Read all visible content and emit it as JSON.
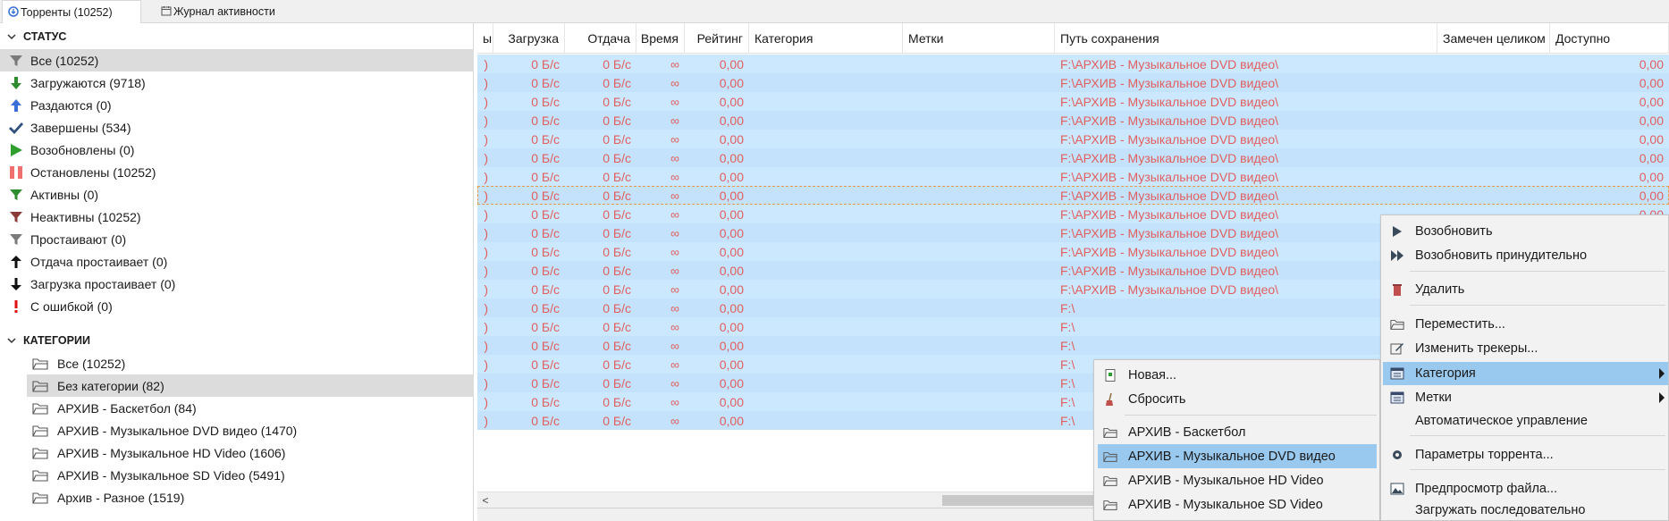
{
  "tabs": [
    {
      "label": "Торренты (10252)",
      "icon": "torrents-icon"
    },
    {
      "label": "Журнал активности",
      "icon": "calendar-icon"
    }
  ],
  "sidebar": {
    "status_header": "СТАТУС",
    "status_items": [
      {
        "label": "Все (10252)",
        "icon": "filter-icon",
        "color": "#7a7a7a"
      },
      {
        "label": "Загружаются (9718)",
        "icon": "download-arrow-icon",
        "color": "#2e8b2e"
      },
      {
        "label": "Раздаются (0)",
        "icon": "upload-arrow-icon",
        "color": "#3a6fd8"
      },
      {
        "label": "Завершены (534)",
        "icon": "checkmark-icon",
        "color": "#2f4f7f"
      },
      {
        "label": "Возобновлены (0)",
        "icon": "play-icon",
        "color": "#2e9e2e"
      },
      {
        "label": "Остановлены (10252)",
        "icon": "pause-icon",
        "color": "#f07070"
      },
      {
        "label": "Активны (0)",
        "icon": "filter-icon",
        "color": "#2e8b2e"
      },
      {
        "label": "Неактивны (10252)",
        "icon": "filter-icon",
        "color": "#8b3a3a"
      },
      {
        "label": "Простаивают (0)",
        "icon": "filter-icon",
        "color": "#7a7a7a"
      },
      {
        "label": "Отдача простаивает (0)",
        "icon": "up-arrow-icon",
        "color": "#111111"
      },
      {
        "label": "Загрузка простаивает (0)",
        "icon": "down-arrow-icon",
        "color": "#111111"
      },
      {
        "label": "С ошибкой (0)",
        "icon": "error-icon",
        "color": "#e01010"
      }
    ],
    "categories_header": "КАТЕГОРИИ",
    "category_items": [
      {
        "label": "Все (10252)"
      },
      {
        "label": "Без категории (82)"
      },
      {
        "label": "АРХИВ - Баскетбол (84)"
      },
      {
        "label": "АРХИВ - Музыкальное DVD видео (1470)"
      },
      {
        "label": "АРХИВ - Музыкальное HD Video (1606)"
      },
      {
        "label": "АРХИВ - Музыкальное SD Video (5491)"
      },
      {
        "label": "Архив - Разное (1519)"
      }
    ]
  },
  "table": {
    "columns": {
      "c0": "ы",
      "download": "Загрузка",
      "upload": "Отдача",
      "time": "Время",
      "rating": "Рейтинг",
      "category": "Категория",
      "tags": "Метки",
      "path": "Путь сохранения",
      "seen": "Замечен целиком",
      "available": "Доступно"
    },
    "row": {
      "c0": ")",
      "download": "0 Б/с",
      "upload": "0 Б/с",
      "time": "∞",
      "rating": "0,00",
      "path": "F:\\АРХИВ - Музыкальное DVD видео\\",
      "path_short": "F:\\",
      "available": "0,00"
    },
    "hscroll_left": "<"
  },
  "context_menu": {
    "items": [
      {
        "label": "Возобновить",
        "icon": "play-icon"
      },
      {
        "label": "Возобновить принудительно",
        "icon": "fast-forward-icon"
      },
      {
        "label": "Удалить",
        "icon": "trash-icon"
      },
      {
        "label": "Переместить...",
        "icon": "folder-icon"
      },
      {
        "label": "Изменить трекеры...",
        "icon": "edit-icon"
      },
      {
        "label": "Категория",
        "icon": "category-icon"
      },
      {
        "label": "Метки",
        "icon": "tags-icon"
      },
      {
        "label": "Автоматическое управление",
        "icon": ""
      },
      {
        "label": "Параметры торрента...",
        "icon": "gear-icon"
      },
      {
        "label": "Предпросмотр файла...",
        "icon": "image-icon"
      },
      {
        "label": "Загружать последовательно",
        "icon": ""
      }
    ]
  },
  "category_submenu": {
    "items": [
      {
        "label": "Новая...",
        "icon": "new-icon"
      },
      {
        "label": "Сбросить",
        "icon": "broom-icon"
      },
      {
        "label": "АРХИВ - Баскетбол",
        "icon": "folder-icon"
      },
      {
        "label": "АРХИВ - Музыкальное DVD видео",
        "icon": "folder-icon"
      },
      {
        "label": "АРХИВ - Музыкальное HD Video",
        "icon": "folder-icon"
      },
      {
        "label": "АРХИВ - Музыкальное SD Video",
        "icon": "folder-icon"
      }
    ]
  },
  "colors": {
    "row_bg": "#cce8ff",
    "row_text": "#e06060",
    "menu_highlight": "#99c9ef"
  }
}
